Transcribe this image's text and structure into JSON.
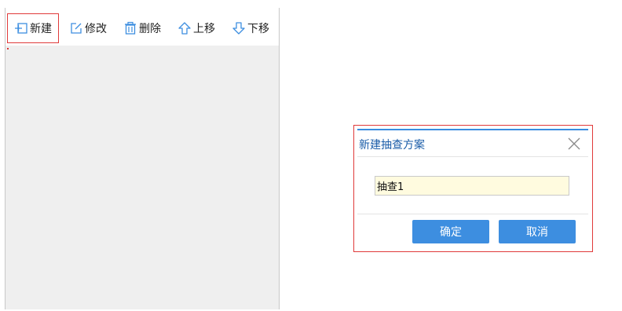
{
  "toolbar": {
    "new_label": "新建",
    "edit_label": "修改",
    "delete_label": "删除",
    "move_up_label": "上移",
    "move_down_label": "下移"
  },
  "dialog": {
    "title": "新建抽查方案",
    "input_value": "抽查1",
    "ok_label": "确定",
    "cancel_label": "取消"
  },
  "colors": {
    "accent": "#3d8ee0",
    "title_text": "#1a5ca8",
    "highlight_border": "#e03a3a",
    "input_background": "#fffbdf",
    "list_background": "#efefef"
  },
  "icons": {
    "new": "add-list-icon",
    "edit": "edit-icon",
    "delete": "trash-icon",
    "move_up": "arrow-up-icon",
    "move_down": "arrow-down-icon",
    "close": "close-icon"
  }
}
